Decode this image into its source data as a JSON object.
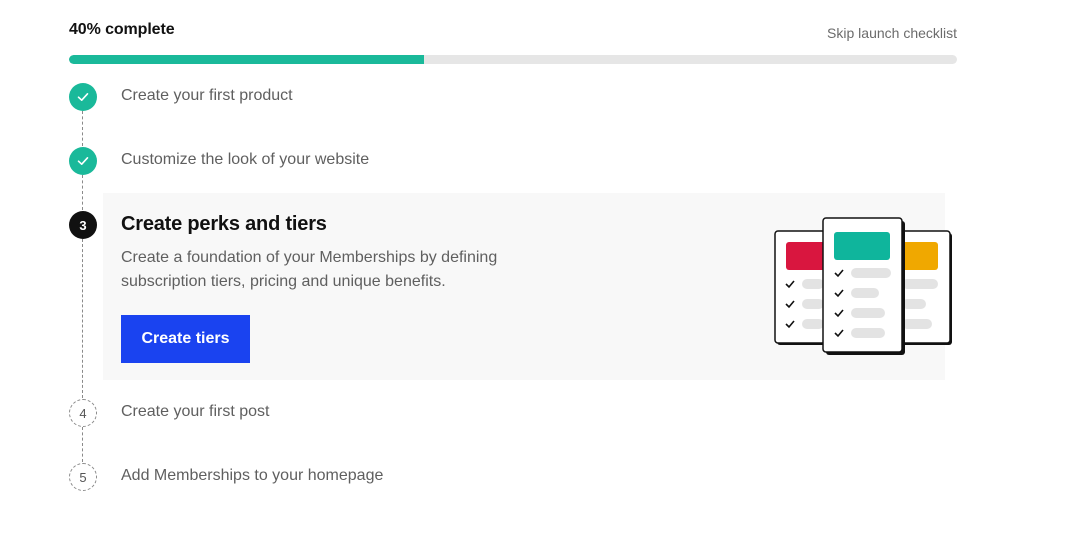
{
  "header": {
    "progress_label": "40% complete",
    "progress_fraction": 0.4,
    "skip_label": "Skip launch checklist"
  },
  "colors": {
    "accent_green": "#1ab99a",
    "primary_blue": "#1a43f0",
    "card_red": "#d9163f",
    "card_teal": "#0fb59c",
    "card_gold": "#f0a800"
  },
  "steps": [
    {
      "number": "1",
      "status": "done",
      "label": "Create your first product"
    },
    {
      "number": "2",
      "status": "done",
      "label": "Customize the look of your website"
    },
    {
      "number": "3",
      "status": "active",
      "label": "Create perks and tiers",
      "description": "Create a foundation of your Memberships by defining subscription tiers, pricing and unique benefits.",
      "button_label": "Create tiers"
    },
    {
      "number": "4",
      "status": "todo",
      "label": "Create your first post"
    },
    {
      "number": "5",
      "status": "todo",
      "label": "Add Memberships to your homepage"
    }
  ],
  "icons": {
    "done_marker": "check-icon",
    "illustration": "tier-cards-illustration"
  }
}
